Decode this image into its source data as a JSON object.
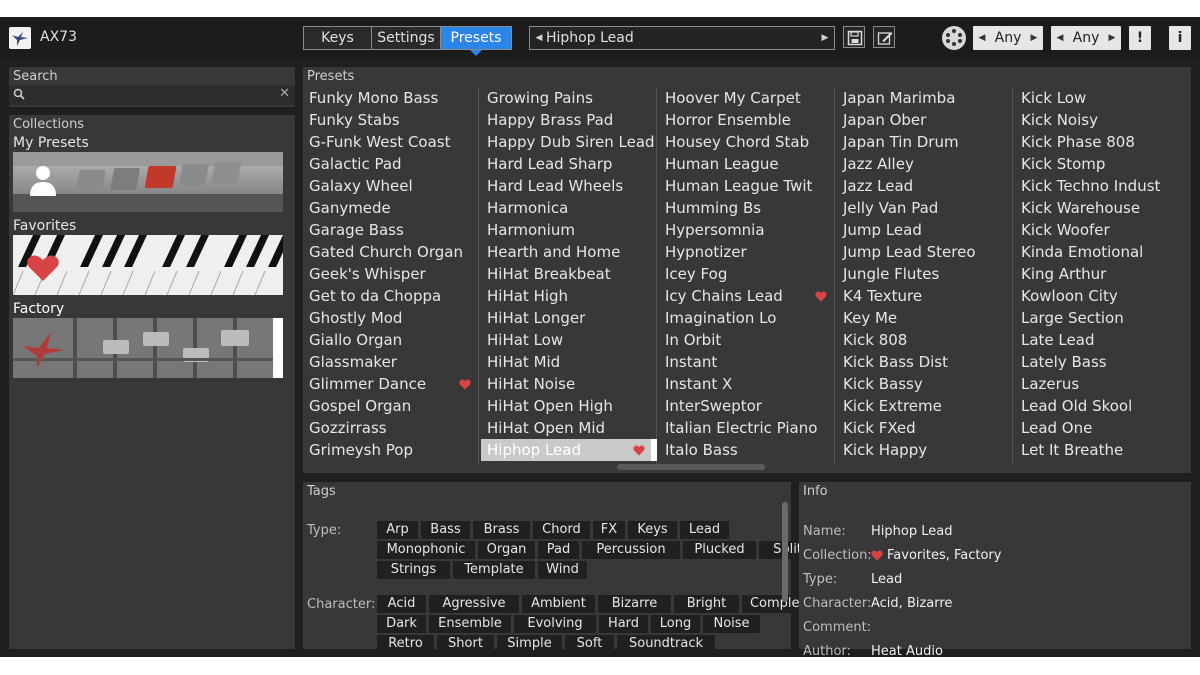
{
  "app": {
    "title": "AX73"
  },
  "tabs": [
    {
      "label": "Keys",
      "active": false
    },
    {
      "label": "Settings",
      "active": false
    },
    {
      "label": "Presets",
      "active": true
    }
  ],
  "preset_selector": {
    "value": "Hiphop Lead"
  },
  "spinners": [
    {
      "value": "Any"
    },
    {
      "value": "Any"
    }
  ],
  "buttons": {
    "alert": "!",
    "info": "i"
  },
  "search": {
    "title": "Search",
    "placeholder": ""
  },
  "collections": {
    "title": "Collections",
    "items": [
      {
        "label": "My Presets",
        "selected": false
      },
      {
        "label": "Favorites",
        "selected": false
      },
      {
        "label": "Factory",
        "selected": true
      }
    ]
  },
  "presets": {
    "title": "Presets",
    "columns": [
      [
        "Funky Mono Bass",
        "Funky Stabs",
        "G-Funk West Coast",
        "Galactic Pad",
        "Galaxy Wheel",
        "Ganymede",
        "Garage Bass",
        "Gated Church Organ",
        "Geek's Whisper",
        "Get to da Choppa",
        "Ghostly Mod",
        "Giallo Organ",
        "Glassmaker",
        "Glimmer Dance",
        "Gospel Organ",
        "Gozzirrass",
        "Grimeysh Pop"
      ],
      [
        "Growing Pains",
        "Happy Brass Pad",
        "Happy Dub Siren Lead",
        "Hard Lead Sharp",
        "Hard Lead Wheels",
        "Harmonica",
        "Harmonium",
        "Hearth and Home",
        "HiHat Breakbeat",
        "HiHat High",
        "HiHat Longer",
        "HiHat Low",
        "HiHat Mid",
        "HiHat Noise",
        "HiHat Open High",
        "HiHat Open Mid",
        "Hiphop Lead"
      ],
      [
        "Hoover My Carpet",
        "Horror Ensemble",
        "Housey Chord Stab",
        "Human League",
        "Human League Twit",
        "Humming Bs",
        "Hypersomnia",
        "Hypnotizer",
        "Icey Fog",
        "Icy Chains Lead",
        "Imagination Lo",
        "In Orbit",
        "Instant",
        "Instant X",
        "InterSweptor",
        "Italian Electric Piano",
        "Italo Bass"
      ],
      [
        "Japan Marimba",
        "Japan Ober",
        "Japan Tin Drum",
        "Jazz Alley",
        "Jazz Lead",
        "Jelly Van Pad",
        "Jump Lead",
        "Jump Lead Stereo",
        "Jungle Flutes",
        "K4 Texture",
        "Key Me",
        "Kick 808",
        "Kick Bass Dist",
        "Kick Bassy",
        "Kick Extreme",
        "Kick FXed",
        "Kick Happy"
      ],
      [
        "Kick Low",
        "Kick Noisy",
        "Kick Phase 808",
        "Kick Stomp",
        "Kick Techno Indust",
        "Kick Warehouse",
        "Kick Woofer",
        "Kinda Emotional",
        "King Arthur",
        "Kowloon City",
        "Large Section",
        "Late Lead",
        "Lately Bass",
        "Lazerus",
        "Lead Old Skool",
        "Lead One",
        "Let It Breathe"
      ]
    ],
    "favorites": [
      "Glimmer Dance",
      "Hiphop Lead",
      "Icy Chains Lead"
    ],
    "selected": "Hiphop Lead"
  },
  "tags": {
    "title": "Tags",
    "type_label": "Type:",
    "type_rows": [
      [
        "Arp",
        "Bass",
        "Brass",
        "Chord",
        "FX",
        "Keys",
        "Lead"
      ],
      [
        "Monophonic",
        "Organ",
        "Pad",
        "Percussion",
        "Plucked",
        "Split"
      ],
      [
        "Strings",
        "Template",
        "Wind"
      ]
    ],
    "character_label": "Character:",
    "character_rows": [
      [
        "Acid",
        "Agressive",
        "Ambient",
        "Bizarre",
        "Bright",
        "Complex"
      ],
      [
        "Dark",
        "Ensemble",
        "Evolving",
        "Hard",
        "Long",
        "Noise"
      ],
      [
        "Retro",
        "Short",
        "Simple",
        "Soft",
        "Soundtrack"
      ]
    ]
  },
  "info": {
    "title": "Info",
    "name_key": "Name:",
    "name": "Hiphop Lead",
    "collection_key": "Collection:",
    "collection": "Favorites, Factory",
    "type_key": "Type:",
    "type": "Lead",
    "character_key": "Character:",
    "character": "Acid, Bizarre",
    "comment_key": "Comment:",
    "comment": "",
    "author_key": "Author:",
    "author": "Heat Audio"
  },
  "colors": {
    "accent": "#2b84e8",
    "favorite": "#d84444",
    "panel": "#383838"
  }
}
